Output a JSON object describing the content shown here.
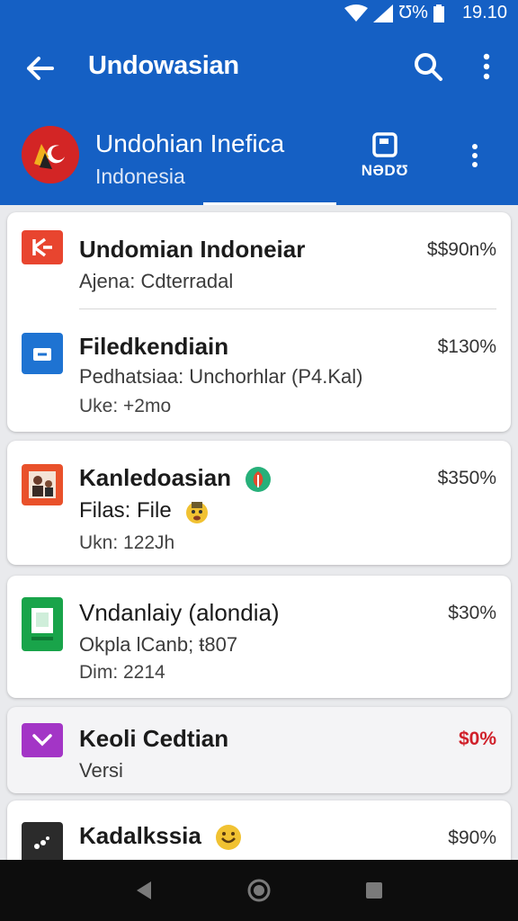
{
  "status_bar": {
    "battery_text": "Ʊ%",
    "time": "19.10"
  },
  "app_bar": {
    "title": "Undowasian",
    "back_icon": "arrow-back-icon",
    "search_icon": "search-icon",
    "more_icon": "more-vert-icon"
  },
  "header": {
    "name": "Undohian Inefica",
    "subtitle": "Indonesia",
    "action_label": "NƏDƱ",
    "action_icon": "save-icon"
  },
  "cards": [
    {
      "rows": [
        {
          "title": "Undomian Indoneiar",
          "line2": "Ajena: Cdterradal",
          "line3": "",
          "price": "$$90n%",
          "icon": "k-app-icon",
          "icon_color": "#e8452f"
        },
        {
          "title": "Filedkendiain",
          "line2": "Pedhatsiaa: Unchorhlar (P4.Kal)",
          "line3": "Uke: +2mo",
          "price": "$130%",
          "icon": "box-app-icon",
          "icon_color": "#1e73d2"
        }
      ]
    },
    {
      "rows": [
        {
          "title": "Kanledoasian",
          "line2": "Filas: File",
          "line3": "Ukn: 122Jh",
          "price": "$350%",
          "icon": "photo-app-icon",
          "icon_color": "#e9512b",
          "title_badge": "green-leaf-badge-icon",
          "line2_badge": "face-emoji-icon"
        }
      ]
    },
    {
      "rows": [
        {
          "title": "Vndanlaiy (alondia)",
          "line2": "Okpla lCanb; ŧ807",
          "line3": "Dim: 2214",
          "price": "$30%",
          "icon": "sheet-app-icon",
          "icon_color": "#19a44a"
        }
      ]
    },
    {
      "rows": [
        {
          "title": "Keoli Cedtian",
          "line2": "Versi",
          "line3": "",
          "price": "$0%",
          "price_color": "#d0202a",
          "icon": "check-app-icon",
          "icon_color": "#a335c6"
        }
      ]
    },
    {
      "rows": [
        {
          "title": "Kadalkssia",
          "line2": "",
          "line3": "",
          "price": "$90%",
          "icon": "dots-app-icon",
          "icon_color": "#2b2b2b",
          "title_badge": "smile-emoji-icon"
        }
      ]
    }
  ],
  "nav_bar": {
    "back": "nav-back-icon",
    "home": "nav-home-icon",
    "recents": "nav-recents-icon"
  },
  "colors": {
    "primary": "#1560c4",
    "background": "#e9eaed",
    "alert_price": "#d0202a"
  }
}
